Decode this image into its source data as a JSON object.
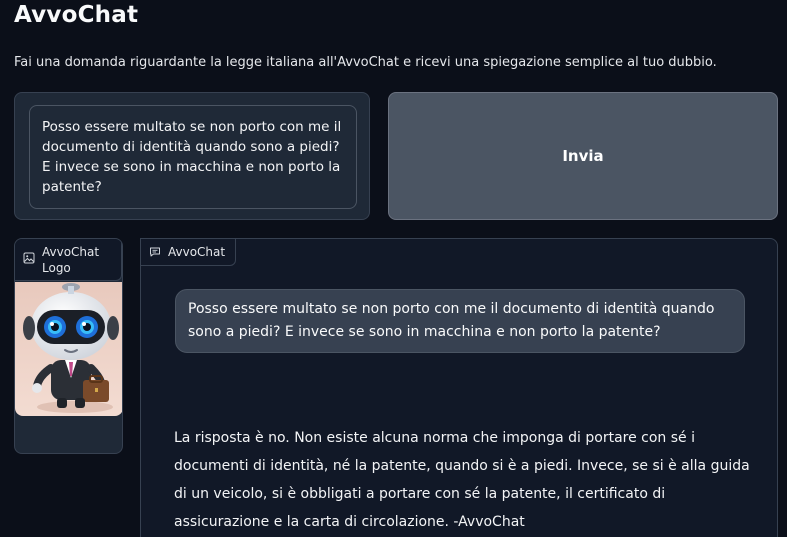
{
  "app": {
    "title": "AvvoChat",
    "description": "Fai una domanda riguardante la legge italiana all'AvvoChat e ricevi una spiegazione semplice al tuo dubbio."
  },
  "input": {
    "value": "Posso essere multato se non porto con me il documento di identità quando sono a piedi? E invece se sono in macchina e non porto la patente?"
  },
  "send_button": {
    "label": "Invia"
  },
  "logo_panel": {
    "label": "AvvoChat Logo",
    "icon": "image-icon"
  },
  "chat_panel": {
    "label": "AvvoChat",
    "icon": "chat-bubble-icon",
    "messages": [
      {
        "role": "user",
        "text": "Posso essere multato se non porto con me il documento di identità quando sono a piedi? E invece se sono in macchina e non porto la patente?"
      },
      {
        "role": "bot",
        "text": "La risposta è no. Non esiste alcuna norma che imponga di portare con sé i documenti di identità, né la patente, quando si è a piedi. Invece, se si è alla guida di un veicolo, si è obbligati a portare con sé la patente, il certificato di assicurazione e la carta di circolazione. -AvvoChat"
      }
    ]
  },
  "colors": {
    "background": "#0b0f19",
    "panel": "#1f2937",
    "button": "#4b5563",
    "user_bubble": "#374151"
  }
}
